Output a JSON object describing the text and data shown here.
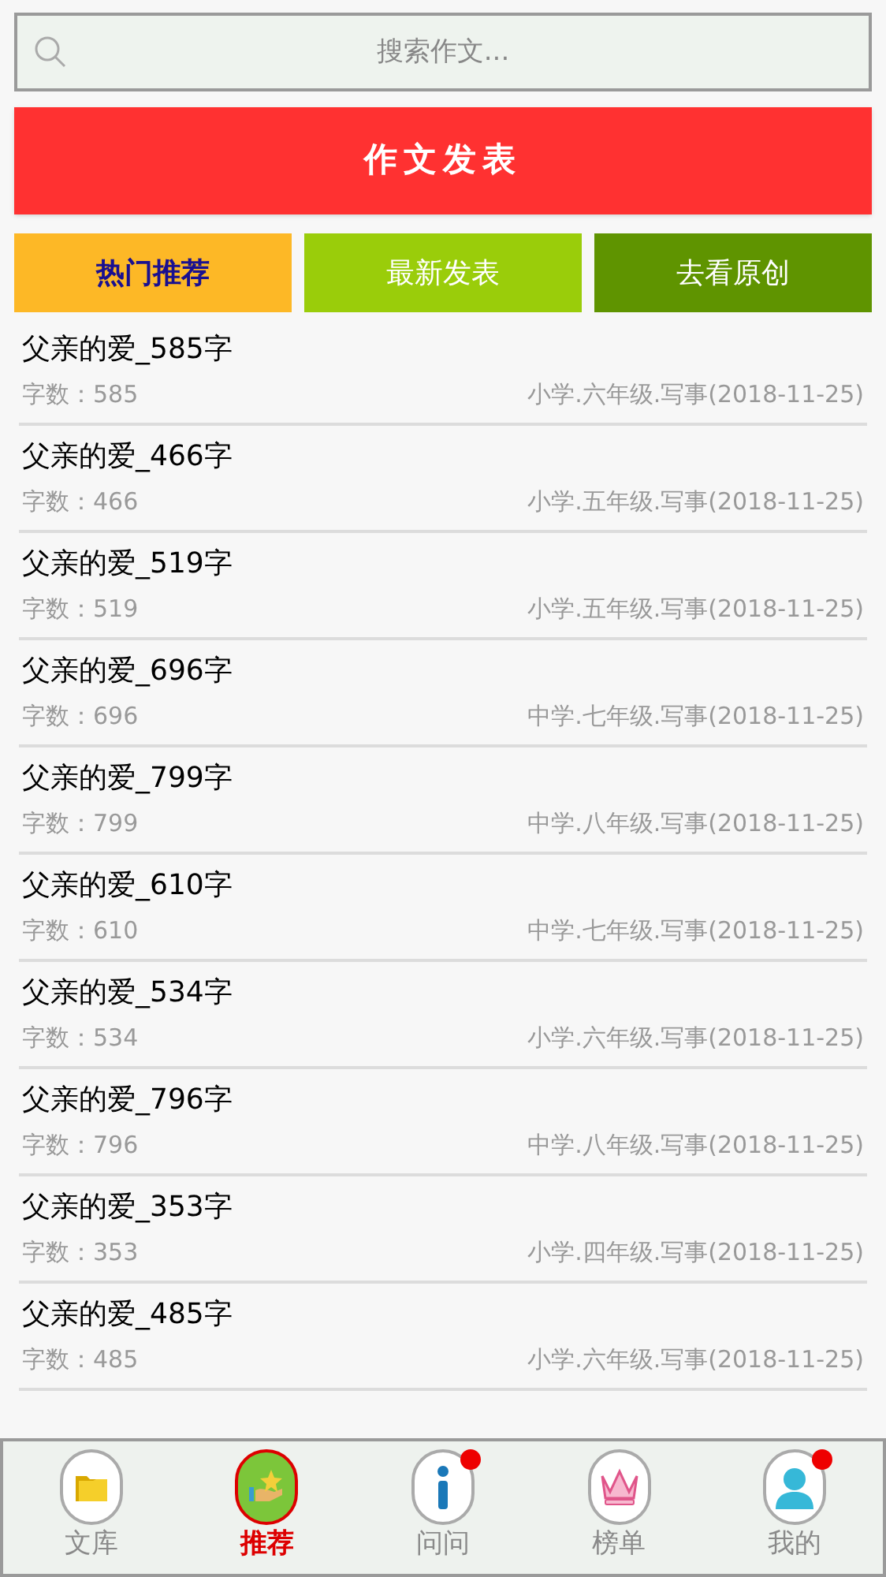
{
  "search": {
    "placeholder": "搜索作文..."
  },
  "publish_button": "作文发表",
  "tabs": [
    {
      "label": "热门推荐",
      "selected": true,
      "color": "#fdb826"
    },
    {
      "label": "最新发表",
      "selected": false,
      "color": "#9acd0a"
    },
    {
      "label": "去看原创",
      "selected": false,
      "color": "#5f9400"
    }
  ],
  "articles": [
    {
      "title": "父亲的爱_585字",
      "count": "字数：585",
      "category": "小学.六年级.写事(2018-11-25)"
    },
    {
      "title": "父亲的爱_466字",
      "count": "字数：466",
      "category": "小学.五年级.写事(2018-11-25)"
    },
    {
      "title": "父亲的爱_519字",
      "count": "字数：519",
      "category": "小学.五年级.写事(2018-11-25)"
    },
    {
      "title": "父亲的爱_696字",
      "count": "字数：696",
      "category": "中学.七年级.写事(2018-11-25)"
    },
    {
      "title": "父亲的爱_799字",
      "count": "字数：799",
      "category": "中学.八年级.写事(2018-11-25)"
    },
    {
      "title": "父亲的爱_610字",
      "count": "字数：610",
      "category": "中学.七年级.写事(2018-11-25)"
    },
    {
      "title": "父亲的爱_534字",
      "count": "字数：534",
      "category": "小学.六年级.写事(2018-11-25)"
    },
    {
      "title": "父亲的爱_796字",
      "count": "字数：796",
      "category": "中学.八年级.写事(2018-11-25)"
    },
    {
      "title": "父亲的爱_353字",
      "count": "字数：353",
      "category": "小学.四年级.写事(2018-11-25)"
    },
    {
      "title": "父亲的爱_485字",
      "count": "字数：485",
      "category": "小学.六年级.写事(2018-11-25)"
    }
  ],
  "bottom_nav": [
    {
      "label": "文库",
      "kind": "folder",
      "selected": false,
      "badge": false
    },
    {
      "label": "推荐",
      "kind": "star",
      "selected": true,
      "badge": false
    },
    {
      "label": "问问",
      "kind": "info",
      "selected": false,
      "badge": true
    },
    {
      "label": "榜单",
      "kind": "crown",
      "selected": false,
      "badge": false
    },
    {
      "label": "我的",
      "kind": "user",
      "selected": false,
      "badge": true
    }
  ]
}
